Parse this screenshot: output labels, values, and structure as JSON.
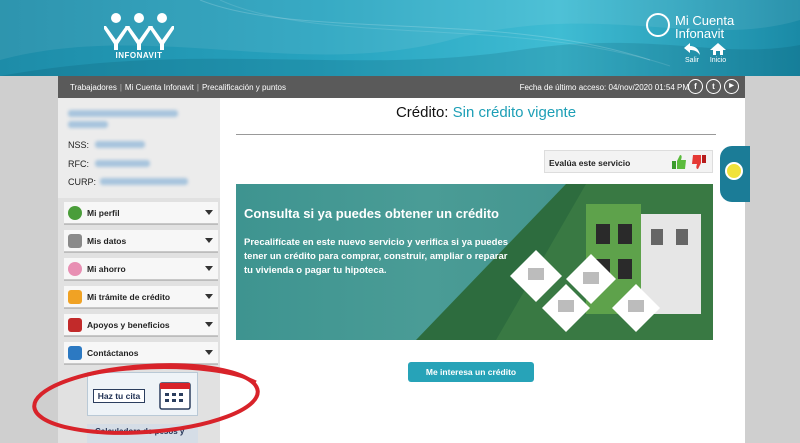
{
  "header": {
    "brand": "INFONAVIT",
    "mi_cuenta_line1": "Mi Cuenta",
    "mi_cuenta_line2": "Infonavit",
    "salir_label": "Salir",
    "inicio_label": "Inicio"
  },
  "navbar": {
    "breadcrumbs": [
      "Trabajadores",
      "Mi Cuenta Infonavit",
      "Precalificación y puntos"
    ],
    "separator": "|",
    "last_access": "Fecha de último acceso: 04/nov/2020 01:54 PM",
    "social": [
      "f",
      "t",
      "▶"
    ]
  },
  "user": {
    "nss_label": "NSS:",
    "rfc_label": "RFC:",
    "curp_label": "CURP:"
  },
  "menu": {
    "items": [
      {
        "label": "Mi perfil",
        "icon": "person-icon"
      },
      {
        "label": "Mis datos",
        "icon": "document-icon"
      },
      {
        "label": "Mi ahorro",
        "icon": "piggy-bank-icon"
      },
      {
        "label": "Mi trámite de crédito",
        "icon": "folder-icon"
      },
      {
        "label": "Apoyos y beneficios",
        "icon": "gift-icon"
      },
      {
        "label": "Contáctanos",
        "icon": "contact-icon"
      }
    ],
    "cita_label": "Haz tu cita",
    "calc_label": "Calculadora de pesos y"
  },
  "main": {
    "credito_label": "Crédito:",
    "credito_value": "Sin crédito vigente",
    "evalua_label": "Evalúa este servicio",
    "banner_title": "Consulta si ya puedes obtener un crédito",
    "banner_body": "Precalifícate en este nuevo servicio y verifica si ya puedes tener un crédito para comprar, construir, ampliar o reparar tu vivienda o pagar tu hipoteca.",
    "cta_label": "Me interesa un crédito"
  },
  "colors": {
    "brand_teal": "#1d9fb6",
    "header_teal": "#27a3bf",
    "nav_gray": "#5a5a5a",
    "banner_green": "#4a9c96",
    "annotation_red": "#d8232a"
  }
}
